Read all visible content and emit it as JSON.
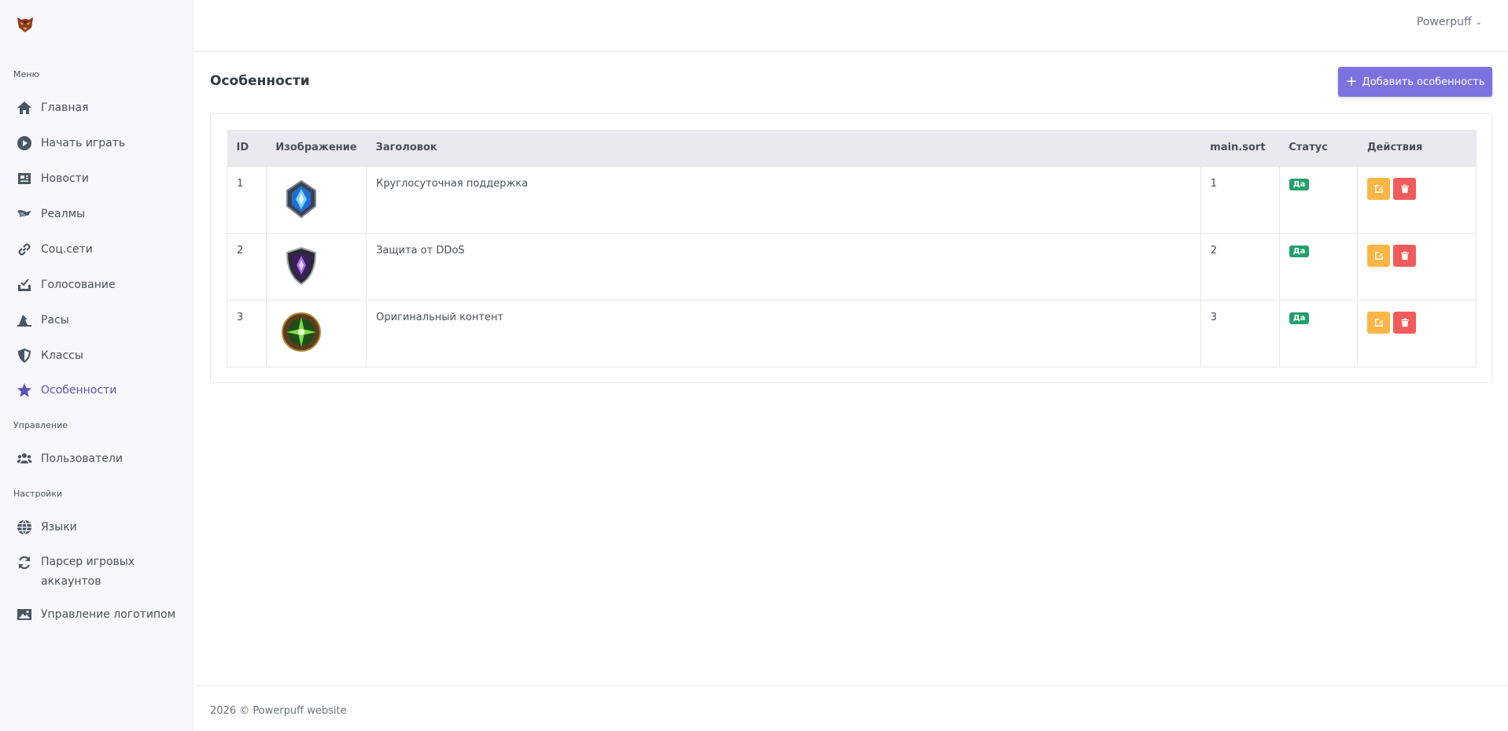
{
  "sidebar": {
    "section_menu": "Меню",
    "section_manage": "Управление",
    "section_settings": "Настройки",
    "items": [
      {
        "label": "Главная",
        "icon": "home-icon"
      },
      {
        "label": "Начать играть",
        "icon": "play-circle-icon"
      },
      {
        "label": "Новости",
        "icon": "newspaper-icon"
      },
      {
        "label": "Реалмы",
        "icon": "dragon-icon"
      },
      {
        "label": "Соц.сети",
        "icon": "link-icon"
      },
      {
        "label": "Голосование",
        "icon": "vote-box-icon"
      },
      {
        "label": "Расы",
        "icon": "hat-wizard-icon"
      },
      {
        "label": "Классы",
        "icon": "shield-icon"
      },
      {
        "label": "Особенности",
        "icon": "star-icon"
      },
      {
        "label": "Пользователи",
        "icon": "users-icon"
      },
      {
        "label": "Языки",
        "icon": "globe-icon"
      },
      {
        "label": "Парсер игровых аккаунтов",
        "icon": "sync-icon"
      },
      {
        "label": "Управление логотипом",
        "icon": "image-icon"
      }
    ]
  },
  "topbar": {
    "user": "Powerpuff"
  },
  "page": {
    "title": "Особенности",
    "add_button": "Добавить особенность"
  },
  "table": {
    "headers": [
      "ID",
      "Изображение",
      "Заголовок",
      "main.sort",
      "Статус",
      "Действия"
    ],
    "rows": [
      {
        "id": "1",
        "title": "Круглосуточная поддержка",
        "sort": "1",
        "status": "Да",
        "image": "blue-crystal-shield"
      },
      {
        "id": "2",
        "title": "Защита от DDoS",
        "sort": "2",
        "status": "Да",
        "image": "purple-shield"
      },
      {
        "id": "3",
        "title": "Оригинальный контент",
        "sort": "3",
        "status": "Да",
        "image": "green-star-emblem"
      }
    ]
  },
  "footer": {
    "text": "2026 © Powerpuff website"
  },
  "colors": {
    "accent": "#7b72e0",
    "active_nav": "#5b52b8",
    "status_green": "#22a06b",
    "edit_orange": "#fbb646",
    "delete_red": "#f25b5b"
  }
}
